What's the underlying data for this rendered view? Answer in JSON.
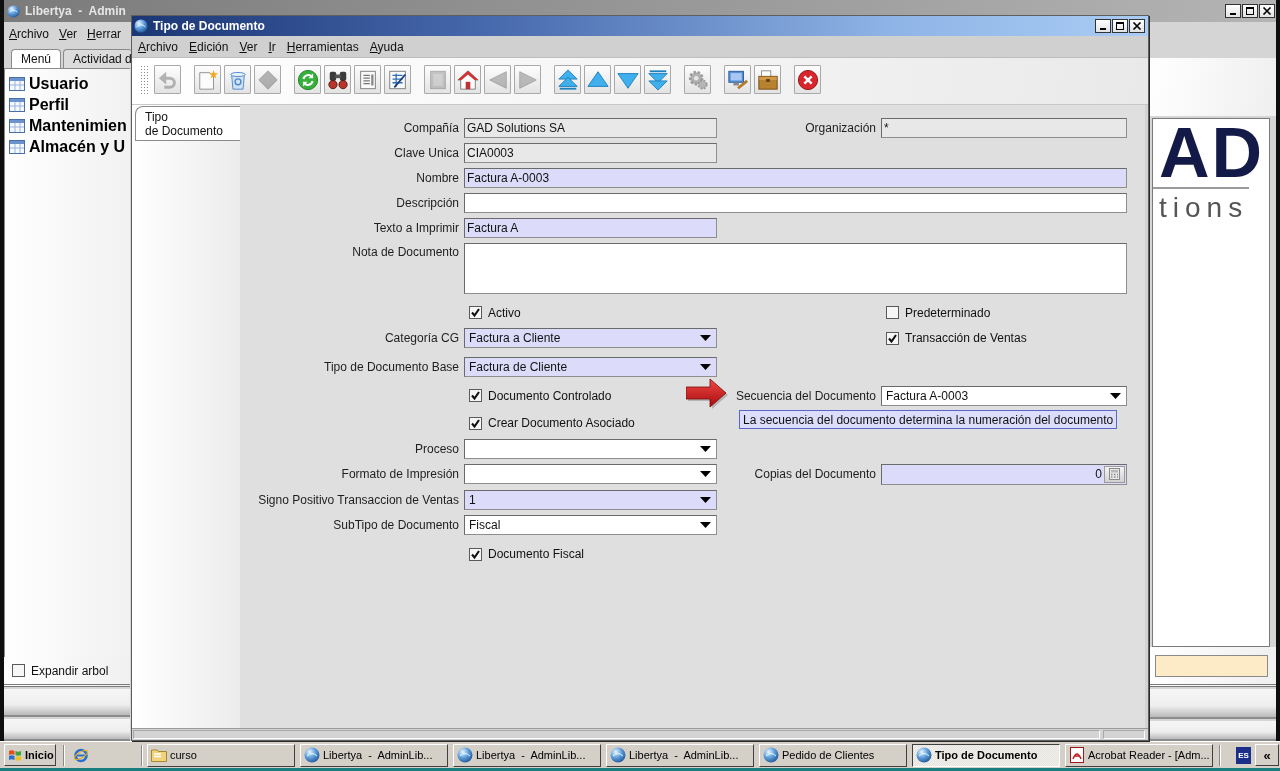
{
  "background_window": {
    "title": "Libertya  -  Admin",
    "menu": [
      "Archivo",
      "Ver",
      "Herrar"
    ],
    "tabs": [
      {
        "label": "Menú",
        "selected": true
      },
      {
        "label": "Actividad d",
        "selected": false
      }
    ],
    "tree": [
      "Usuario",
      "Perfil",
      "Mantenimien",
      "Almacén y U"
    ],
    "expand_tree": {
      "label": "Expandir arbol",
      "checked": false
    },
    "logo": {
      "mark": "AD",
      "tagline": "tions"
    }
  },
  "window": {
    "title": "Tipo de Documento",
    "menu": [
      "Archivo",
      "Edición",
      "Ver",
      "Ir",
      "Herramientas",
      "Ayuda"
    ],
    "toolbar": [
      {
        "buttons": [
          {
            "disabled": true
          }
        ]
      },
      {
        "buttons": [
          {
            "disabled": false
          },
          {
            "disabled": false
          },
          {
            "disabled": true
          }
        ]
      },
      {
        "buttons": [
          {
            "disabled": false
          },
          {
            "disabled": false
          },
          {
            "disabled": false
          },
          {
            "disabled": false
          }
        ]
      },
      {
        "buttons": [
          {
            "disabled": true
          },
          {
            "disabled": false
          },
          {
            "disabled": true
          },
          {
            "disabled": true
          }
        ]
      },
      {
        "buttons": [
          {
            "disabled": false
          },
          {
            "disabled": false
          },
          {
            "disabled": false
          },
          {
            "disabled": false
          }
        ]
      },
      {
        "buttons": [
          {
            "disabled": true
          }
        ]
      },
      {
        "buttons": [
          {
            "disabled": false
          },
          {
            "disabled": false
          }
        ]
      },
      {
        "buttons": [
          {
            "disabled": false
          }
        ]
      }
    ],
    "tabs": [
      {
        "label": "Tipo\nde Documento",
        "selected": true
      }
    ],
    "form": {
      "rows": [
        {
          "left": {
            "kind": "text",
            "label": "Compañía",
            "value": "GAD Solutions SA",
            "readonly": true,
            "mandatory": false
          },
          "right": {
            "kind": "text",
            "label": "Organización",
            "value": "*",
            "readonly": true,
            "mandatory": false
          }
        },
        {
          "left": {
            "kind": "text",
            "label": "Clave Unica",
            "value": "CIA0003",
            "readonly": true,
            "mandatory": false
          }
        },
        {
          "left": {
            "kind": "text",
            "label": "Nombre",
            "value": "Factura A-0003",
            "readonly": false,
            "mandatory": true
          }
        },
        {
          "left": {
            "kind": "text",
            "label": "Descripción",
            "readonly": false,
            "mandatory": false
          }
        },
        {
          "left": {
            "kind": "text",
            "label": "Texto a Imprimir",
            "value": "Factura A",
            "readonly": false,
            "mandatory": true
          }
        },
        {
          "left": {
            "kind": "textarea",
            "label": "Nota de Documento",
            "readonly": false,
            "mandatory": false
          }
        },
        {
          "left": {
            "kind": "checkbox",
            "label": "Activo",
            "checked": true
          },
          "right": {
            "kind": "checkbox",
            "label": "Predeterminado",
            "checked": false
          }
        },
        {
          "left": {
            "kind": "combo",
            "label": "Categoría CG",
            "value": "Factura a Cliente",
            "readonly": false,
            "mandatory": true
          },
          "right": {
            "kind": "checkbox",
            "label": "Transacción de Ventas",
            "checked": true
          }
        },
        {
          "left": {
            "kind": "combo",
            "label": "Tipo de Documento Base",
            "value": "Factura de Cliente",
            "readonly": false,
            "mandatory": true
          }
        },
        {
          "left": {
            "kind": "checkbox",
            "label": "Documento Controlado",
            "checked": true
          },
          "right": {
            "kind": "combo",
            "label": "Secuencia del Documento",
            "value": "Factura A-0003",
            "readonly": false,
            "mandatory": false
          }
        },
        {
          "left": {
            "kind": "checkbox",
            "label": "Crear Documento Asociado",
            "checked": true
          }
        },
        {
          "left": {
            "kind": "combo",
            "label": "Proceso",
            "readonly": false,
            "mandatory": false
          }
        },
        {
          "left": {
            "kind": "combo",
            "label": "Formato de Impresión",
            "readonly": false,
            "mandatory": false
          },
          "right": {
            "kind": "number",
            "label": "Copias del Documento",
            "value": "0",
            "readonly": false,
            "mandatory": true
          }
        },
        {
          "left": {
            "kind": "combo",
            "label": "Signo Positivo Transaccion de Ventas",
            "value": "1",
            "readonly": false,
            "mandatory": true
          }
        },
        {
          "left": {
            "kind": "combo",
            "label": "SubTipo de Documento",
            "value": "Fiscal",
            "readonly": false,
            "mandatory": false
          }
        },
        {
          "left": {
            "kind": "checkbox",
            "label": "Documento Fiscal",
            "checked": true
          }
        }
      ],
      "tooltip": "La secuencia del documento determina la numeración del documento"
    }
  },
  "taskbar": {
    "start": "Inicio",
    "tasks": [
      {
        "label": "curso",
        "kind": "folder",
        "selected": false
      },
      {
        "label": "Libertya  -  AdminLib...",
        "kind": "window",
        "selected": false
      },
      {
        "label": "Libertya  -  AdminLib...",
        "kind": "window",
        "selected": false
      },
      {
        "label": "Libertya  -  AdminLib...",
        "kind": "window",
        "selected": false
      },
      {
        "label": "Pedido de Clientes",
        "kind": "window",
        "selected": false
      },
      {
        "label": "Tipo de Documento",
        "kind": "window",
        "selected": true
      },
      {
        "label": "Acrobat Reader - [Adm...",
        "kind": "document",
        "selected": false
      }
    ],
    "language": "ES",
    "tray_toggle": "«"
  }
}
